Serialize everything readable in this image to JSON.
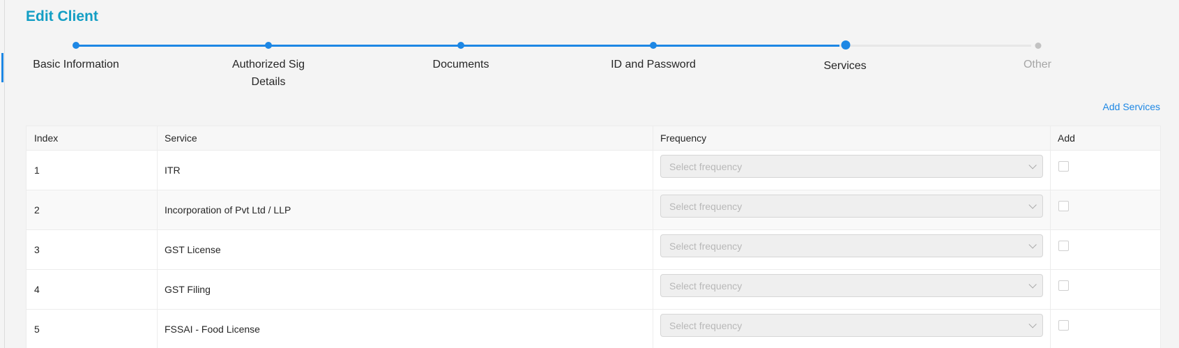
{
  "page": {
    "title": "Edit Client"
  },
  "steps": [
    {
      "label": "Basic Information",
      "state": "done"
    },
    {
      "label": "Authorized Sig Details",
      "state": "done"
    },
    {
      "label": "Documents",
      "state": "done"
    },
    {
      "label": "ID and Password",
      "state": "done"
    },
    {
      "label": "Services",
      "state": "current"
    },
    {
      "label": "Other",
      "state": "pending"
    }
  ],
  "actions": {
    "add_services": "Add Services"
  },
  "table": {
    "headers": {
      "index": "Index",
      "service": "Service",
      "frequency": "Frequency",
      "add": "Add"
    },
    "rows": [
      {
        "index": "1",
        "service": "ITR",
        "frequency_placeholder": "Select frequency",
        "checked": false
      },
      {
        "index": "2",
        "service": "Incorporation of Pvt Ltd / LLP",
        "frequency_placeholder": "Select frequency",
        "checked": false
      },
      {
        "index": "3",
        "service": "GST License",
        "frequency_placeholder": "Select frequency",
        "checked": false
      },
      {
        "index": "4",
        "service": "GST Filing",
        "frequency_placeholder": "Select frequency",
        "checked": false
      },
      {
        "index": "5",
        "service": "FSSAI - Food License",
        "frequency_placeholder": "Select frequency",
        "checked": false
      }
    ]
  },
  "colors": {
    "accent": "#1d87e4",
    "title": "#139ec4",
    "pending": "#a6a6a6"
  }
}
